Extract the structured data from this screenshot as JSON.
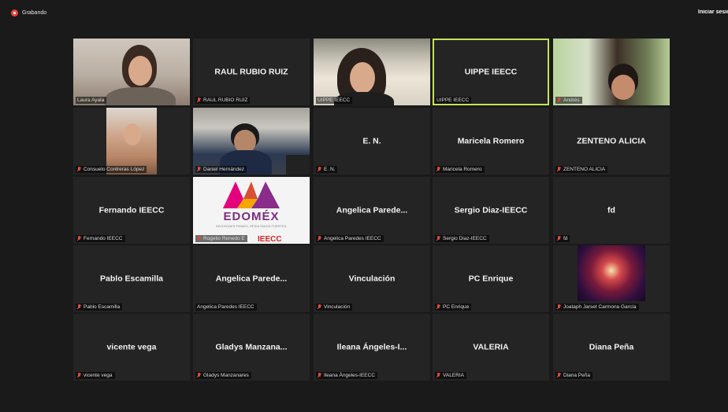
{
  "recording": {
    "label": "Grabando"
  },
  "header": {
    "signin_label": "Iniciar sesión"
  },
  "accent": "#c5e35c",
  "mute_color": "#e8453c",
  "tiles": [
    {
      "center": "",
      "tag": "Laura Ayala",
      "muted": false,
      "video": "laura"
    },
    {
      "center": "RAUL RUBIO RUIZ",
      "tag": "RAUL RUBIO RUIZ",
      "muted": true
    },
    {
      "center": "",
      "tag": "UIPPE IEECC",
      "muted": false,
      "video": "uippe-video"
    },
    {
      "center": "UIPPE IEECC",
      "tag": "UIPPE IEECC",
      "muted": false,
      "active": true
    },
    {
      "center": "",
      "tag": "Andrés",
      "muted": true,
      "video": "andres"
    },
    {
      "center": "",
      "tag": "Consuelo Contreras López",
      "muted": true,
      "video": "consuelo"
    },
    {
      "center": "",
      "tag": "Daniel Hernández",
      "muted": true,
      "video": "daniel"
    },
    {
      "center": "E. N.",
      "tag": "E. N.",
      "muted": true
    },
    {
      "center": "Maricela Romero",
      "tag": "Maricela Romero",
      "muted": true
    },
    {
      "center": "ZENTENO ALICIA",
      "tag": "ZENTENO ALICIA",
      "muted": true
    },
    {
      "center": "Fernando IEECC",
      "tag": "Fernando IEECC",
      "muted": true
    },
    {
      "center": "",
      "tag": "Rogelio Renedo E",
      "muted": true,
      "video": "edomex"
    },
    {
      "center": "Angelica Parede...",
      "tag": "Angelica Paredes IEECC",
      "muted": true
    },
    {
      "center": "Sergio Diaz-IEECC",
      "tag": "Sergio Diaz-IEECC",
      "muted": true
    },
    {
      "center": "fd",
      "tag": "fd",
      "muted": true
    },
    {
      "center": "Pablo Escamilla",
      "tag": "Pablo Escamilla",
      "muted": true
    },
    {
      "center": "Angelica Parede...",
      "tag": "Angelica Paredes IEECC",
      "muted": false
    },
    {
      "center": "Vinculación",
      "tag": "Vinculación",
      "muted": true
    },
    {
      "center": "PC Enrique",
      "tag": "PC Enrique",
      "muted": true
    },
    {
      "center": "",
      "tag": "Joataph Jarset Carmona García",
      "muted": true,
      "video": "joataph"
    },
    {
      "center": "vicente vega",
      "tag": "vicente vega",
      "muted": true
    },
    {
      "center": "Gladys Manzana...",
      "tag": "Gladys Manzanares",
      "muted": true
    },
    {
      "center": "Ileana Ángeles-I...",
      "tag": "Ileana Ángeles-IEECC",
      "muted": true
    },
    {
      "center": "VALERIA",
      "tag": "VALERIA",
      "muted": true
    },
    {
      "center": "Diana Peña",
      "tag": "Diana Peña",
      "muted": true
    }
  ],
  "edomex": {
    "brand": "EDOMÉX",
    "tagline": "DECISIONES FIRMES, RESULTADOS FUERTES.",
    "overlay": "IEECC"
  }
}
